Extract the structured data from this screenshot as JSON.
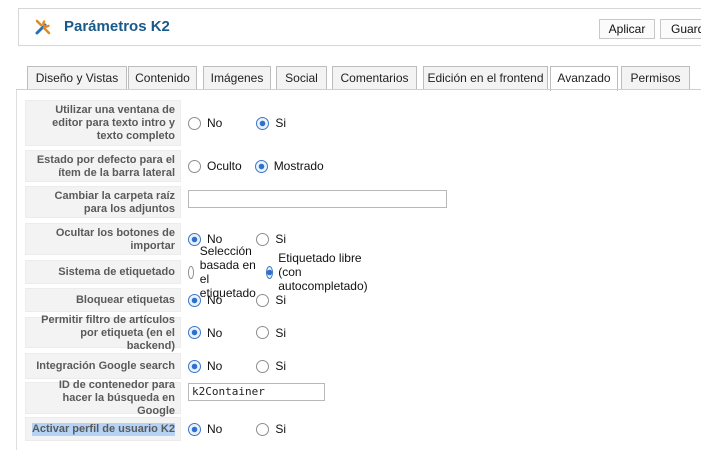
{
  "header": {
    "title": "Parámetros K2",
    "apply_label": "Aplicar",
    "save_label": "Guard"
  },
  "tabs": [
    {
      "label": "Diseño y Vistas",
      "active": false
    },
    {
      "label": "Contenido",
      "active": false
    },
    {
      "label": "Imágenes",
      "active": false
    },
    {
      "label": "Social",
      "active": false
    },
    {
      "label": "Comentarios",
      "active": false
    },
    {
      "label": "Edición en el frontend",
      "active": false
    },
    {
      "label": "Avanzado",
      "active": true
    },
    {
      "label": "Permisos",
      "active": false
    }
  ],
  "settings": [
    {
      "label": "Utilizar una ventana de editor para texto intro y texto completo",
      "type": "radio",
      "options": [
        "No",
        "Si"
      ],
      "selected": 1
    },
    {
      "label": "Estado por defecto para el ítem de la barra lateral",
      "type": "radio",
      "options": [
        "Oculto",
        "Mostrado"
      ],
      "selected": 1
    },
    {
      "label": "Cambiar la carpeta raíz para los adjuntos",
      "type": "text",
      "value": ""
    },
    {
      "label": "Ocultar los botones de importar",
      "type": "radio",
      "options": [
        "No",
        "Si"
      ],
      "selected": 0
    },
    {
      "label": "Sistema de etiquetado",
      "type": "radio",
      "options": [
        "Selección basada en el etiquetado",
        "Etiquetado libre (con autocompletado)"
      ],
      "selected": 1
    },
    {
      "label": "Bloquear etiquetas",
      "type": "radio",
      "options": [
        "No",
        "Si"
      ],
      "selected": 0
    },
    {
      "label": "Permitir filtro de artículos por etiqueta (en el backend)",
      "type": "radio",
      "options": [
        "No",
        "Si"
      ],
      "selected": 0
    },
    {
      "label": "Integración Google search",
      "type": "radio",
      "options": [
        "No",
        "Si"
      ],
      "selected": 0
    },
    {
      "label": "ID de contenedor para hacer la búsqueda en Google",
      "type": "text",
      "value": "k2Container"
    },
    {
      "label": "Activar perfil de usuario K2",
      "type": "radio",
      "options": [
        "No",
        "Si"
      ],
      "selected": 0,
      "highlighted": true
    }
  ],
  "colors": {
    "title": "#1a5a8a",
    "radio_selected": "#2f6fd0",
    "label_bg": "#f3f3f3",
    "highlight": "#b5d3f5"
  }
}
